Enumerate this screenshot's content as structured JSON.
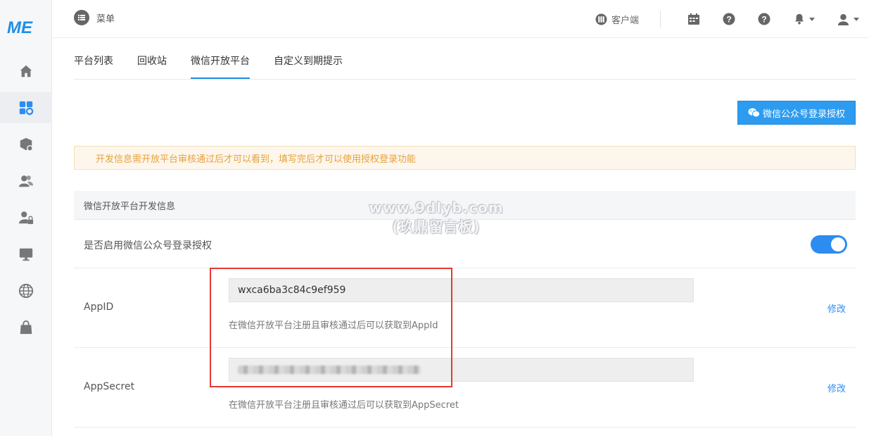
{
  "sidebar": {
    "logo": "ME",
    "items": [
      {
        "name": "home-icon"
      },
      {
        "name": "apps-icon",
        "active": true
      },
      {
        "name": "package-icon"
      },
      {
        "name": "users-icon"
      },
      {
        "name": "user-lock-icon"
      },
      {
        "name": "monitor-icon"
      },
      {
        "name": "globe-icon"
      },
      {
        "name": "shopping-bag-icon"
      }
    ]
  },
  "header": {
    "menu_label": "菜单",
    "client_label": "客户端"
  },
  "tabs": [
    {
      "label": "平台列表"
    },
    {
      "label": "回收站"
    },
    {
      "label": "微信开放平台",
      "active": true
    },
    {
      "label": "自定义到期提示"
    }
  ],
  "auth_button_label": "微信公众号登录授权",
  "alert_text": "开发信息需开放平台审核通过后才可以看到，填写完后才可以使用授权登录功能",
  "section_title": "微信开放平台开发信息",
  "enable_row": {
    "label": "是否启用微信公众号登录授权",
    "enabled": true
  },
  "appid_row": {
    "label": "AppID",
    "value": "wxca6ba3c84c9ef959",
    "hint": "在微信开放平台注册且审核通过后可以获取到AppId",
    "edit_label": "修改"
  },
  "secret_row": {
    "label": "AppSecret",
    "hint": "在微信开放平台注册且审核通过后可以获取到AppSecret",
    "edit_label": "修改"
  },
  "watermark": {
    "line1": "www.9dlyb.com",
    "line2": "(玖鼎留言板)"
  },
  "colors": {
    "accent": "#2d8cf0",
    "alert_text": "#e6a23c",
    "highlight_box": "#e53935"
  }
}
